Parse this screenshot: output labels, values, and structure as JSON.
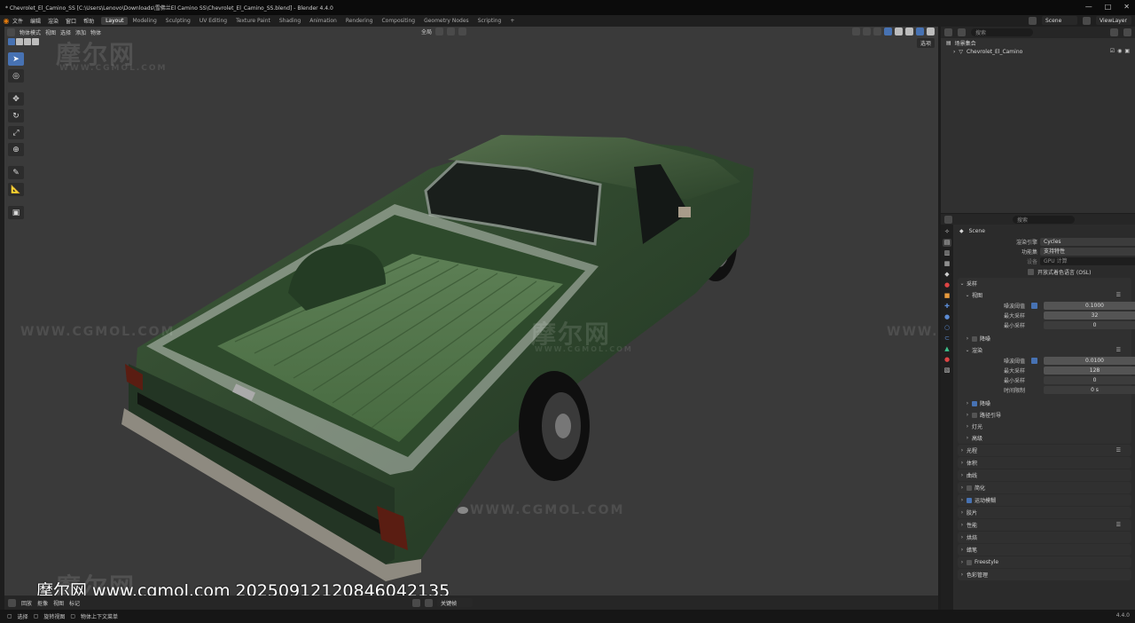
{
  "window": {
    "title": "* Chevrolet_El_Camino_SS [C:\\Users\\Lenovo\\Downloads\\雪佛兰El Camino SS\\Chevrolet_El_Camino_SS.blend] - Blender 4.4.0",
    "controls": [
      "—",
      "□",
      "✕"
    ]
  },
  "menus": [
    "文件",
    "编辑",
    "渲染",
    "窗口",
    "帮助"
  ],
  "workspaces": [
    "Layout",
    "Modeling",
    "Sculpting",
    "UV Editing",
    "Texture Paint",
    "Shading",
    "Animation",
    "Rendering",
    "Compositing",
    "Geometry Nodes",
    "Scripting",
    "+"
  ],
  "active_workspace": "Layout",
  "topbar_right": {
    "scene": "Scene",
    "view_layer": "ViewLayer"
  },
  "viewport": {
    "mode": "物体模式",
    "menus": [
      "视图",
      "选择",
      "添加",
      "物体"
    ],
    "transform": "全局",
    "view_label": "选项",
    "footer_text": "摩尔网 www.cgmol.com 20250912120846042135"
  },
  "watermarks": {
    "logo": "摩尔网",
    "url": "WWW.CGMOL.COM"
  },
  "toolbar_icons": [
    "cursor-select-icon",
    "cursor-icon",
    "move-icon",
    "rotate-icon",
    "scale-icon",
    "transform-icon",
    "annotate-icon",
    "measure-icon",
    "add-cube-icon"
  ],
  "timeline": {
    "menus": [
      "回放",
      "抠像",
      "视图",
      "标记"
    ],
    "keying": "关键帧"
  },
  "statusbar": {
    "select": "选择",
    "rotate": "旋转视图",
    "context": "物体上下文菜单",
    "version": "4.4.0"
  },
  "outliner": {
    "search_placeholder": "搜索",
    "collection": "场景集合",
    "object": "Chevrolet_El_Camino"
  },
  "properties": {
    "search_placeholder": "搜索",
    "scene": "Scene",
    "render_engine_label": "渲染引擎",
    "render_engine": "Cycles",
    "feature_set_label": "功能集",
    "feature_set": "支持特性",
    "device_label": "设备",
    "device": "GPU 计算",
    "osl_label": "开放式着色语言 (OSL)",
    "sampling": "采样",
    "viewport_section": "视图",
    "vp_noise_label": "噪波阈值",
    "vp_noise": "0.1000",
    "vp_max_label": "最大采样",
    "vp_max": "32",
    "vp_min_label": "最小采样",
    "vp_min": "0",
    "denoise": "降噪",
    "render_section": "渲染",
    "r_noise_label": "噪波阈值",
    "r_noise": "0.0100",
    "r_max_label": "最大采样",
    "r_max": "128",
    "r_min_label": "最小采样",
    "r_min": "0",
    "r_time_label": "时间限制",
    "r_time": "0 s",
    "sub_sections": [
      "降噪",
      "路径引导",
      "灯光",
      "高级"
    ],
    "sections": [
      "光程",
      "体积",
      "曲线",
      "简化",
      "运动模糊",
      "胶片",
      "性能",
      "烘焙",
      "蜡笔",
      "Freestyle",
      "色彩管理"
    ]
  }
}
